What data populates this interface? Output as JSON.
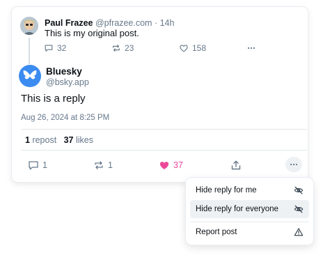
{
  "parent_post": {
    "author_name": "Paul Frazee",
    "author_handle": "@pfrazee.com",
    "separator": "·",
    "time": "14h",
    "text": "This is my original post.",
    "replies": "32",
    "reposts": "23",
    "likes": "158"
  },
  "reply_post": {
    "author_name": "Bluesky",
    "author_handle": "@bsky.app",
    "text": "This is a reply",
    "date": "Aug 26, 2024 at 8:25 PM",
    "repost_count": "1",
    "repost_label": "repost",
    "like_count": "37",
    "like_label": "likes",
    "replies": "1",
    "reposts": "1",
    "likes": "37"
  },
  "menu": {
    "items": [
      {
        "label": "Hide reply for me",
        "icon": "eye-slash-icon"
      },
      {
        "label": "Hide reply for everyone",
        "icon": "eye-slash-icon"
      },
      {
        "label": "Report post",
        "icon": "warning-triangle-icon"
      }
    ]
  },
  "colors": {
    "accent_blue": "#3b8bf0",
    "like_pink": "#ec4899",
    "muted": "#66788a"
  }
}
